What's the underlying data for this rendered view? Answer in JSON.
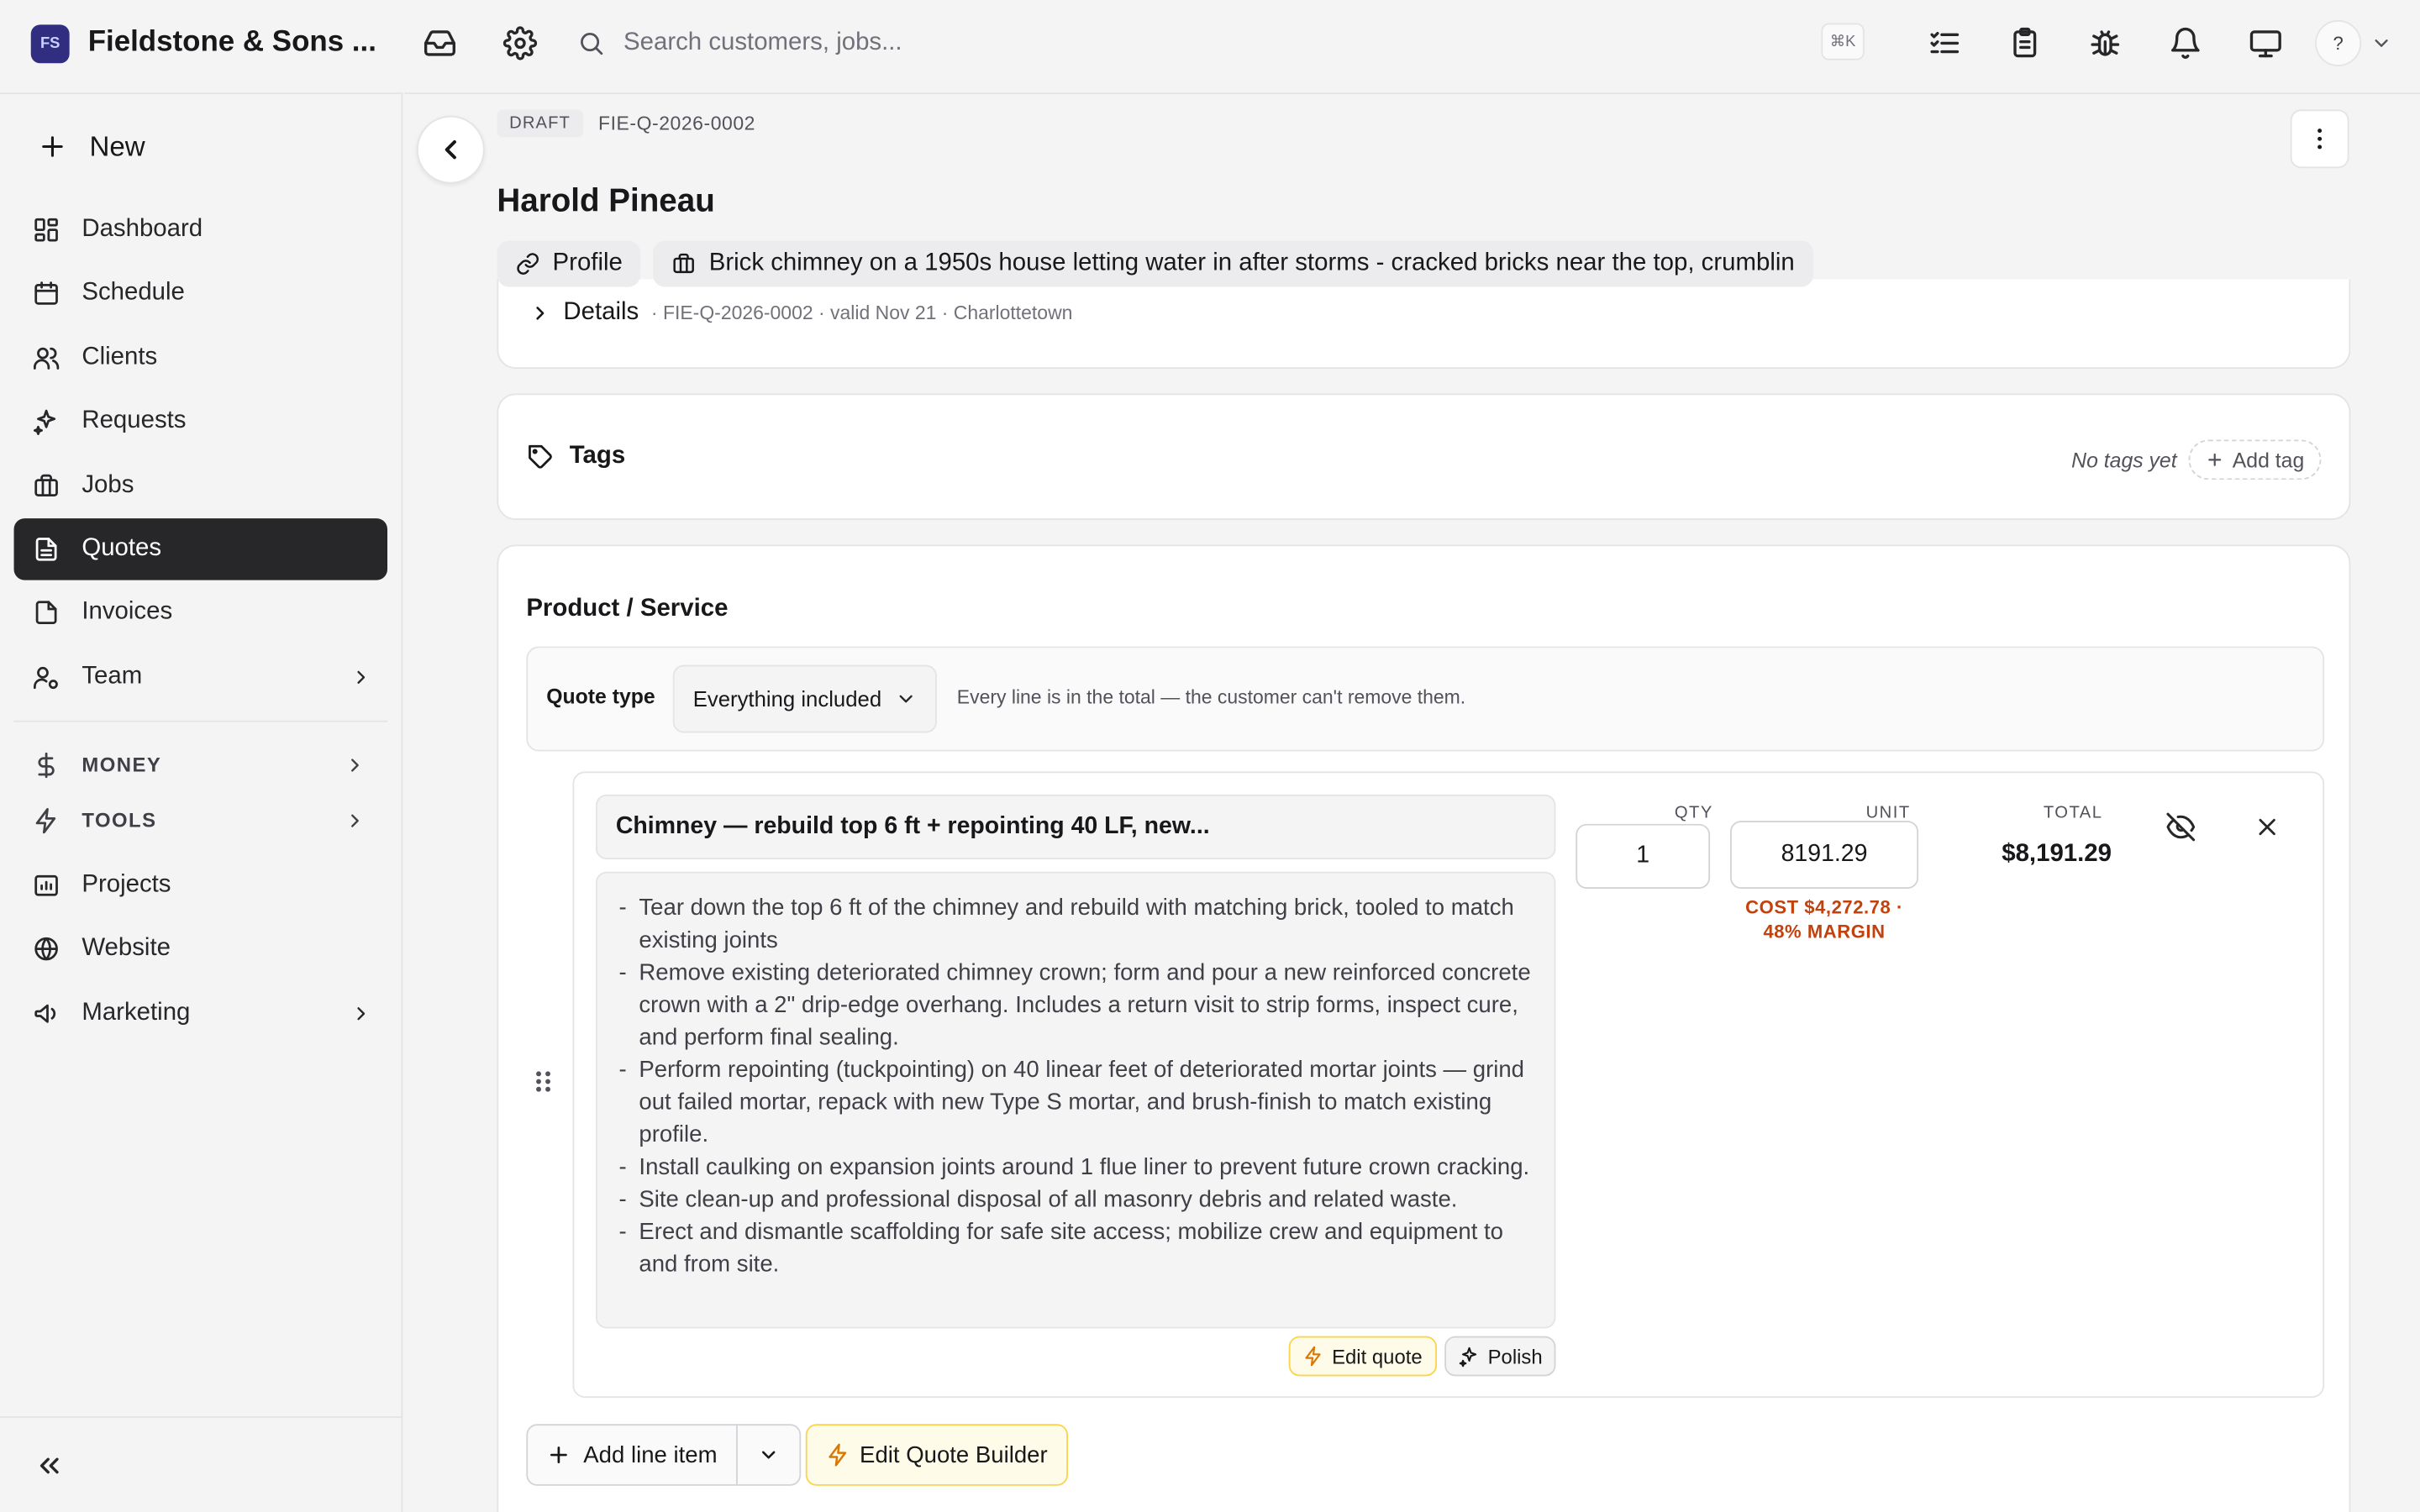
{
  "app": {
    "brand_name": "Fieldstone & Sons ...",
    "brand_logo_text": "FS"
  },
  "topbar": {
    "search_placeholder": "Search customers, jobs...",
    "shortcut": "⌘K",
    "help": "?"
  },
  "sidebar": {
    "new_label": "New",
    "items": [
      {
        "label": "Dashboard"
      },
      {
        "label": "Schedule"
      },
      {
        "label": "Clients"
      },
      {
        "label": "Requests"
      },
      {
        "label": "Jobs"
      },
      {
        "label": "Quotes",
        "active": true
      },
      {
        "label": "Invoices"
      },
      {
        "label": "Team"
      }
    ],
    "sections": [
      {
        "label": "MONEY"
      },
      {
        "label": "TOOLS"
      }
    ],
    "bottom_items": [
      {
        "label": "Projects"
      },
      {
        "label": "Website"
      },
      {
        "label": "Marketing"
      }
    ]
  },
  "quote": {
    "status": "DRAFT",
    "number": "FIE-Q-2026-0002",
    "client_name": "Harold Pineau",
    "chips": {
      "profile": "Profile",
      "job": "Brick chimney on a 1950s house letting water in after storms - cracked bricks near the top, crumblin"
    },
    "details": {
      "label": "Details",
      "meta": "· FIE-Q-2026-0002 · valid Nov 21 · Charlottetown"
    },
    "tags": {
      "label": "Tags",
      "empty": "No tags yet",
      "add": "Add tag"
    },
    "product_service": {
      "title": "Product / Service",
      "quote_type_label": "Quote type",
      "quote_type_value": "Everything included",
      "quote_type_hint": "Every line is in the total — the customer can't remove them.",
      "columns": {
        "qty": "QTY",
        "unit": "UNIT",
        "total": "TOTAL"
      },
      "line_items": [
        {
          "name": "Chimney — rebuild top 6 ft + repointing 40 LF, new...",
          "description": [
            "Tear down the top 6 ft of the chimney and rebuild with matching brick, tooled to match existing joints",
            "Remove existing deteriorated chimney crown; form and pour a new reinforced concrete crown with a 2\" drip-edge overhang. Includes a return visit to strip forms, inspect cure, and perform final sealing.",
            "Perform repointing (tuckpointing) on 40 linear feet of deteriorated mortar joints — grind out failed mortar, repack with new Type S mortar, and brush-finish to match existing profile.",
            "Install caulking on expansion joints around 1 flue liner to prevent future crown cracking.",
            "Site clean-up and professional disposal of all masonry debris and related waste.",
            "Erect and dismantle scaffolding for safe site access; mobilize crew and equipment to and from site."
          ],
          "qty": "1",
          "unit": "8191.29",
          "cost_note": "COST $4,272.78 · 48% MARGIN",
          "total": "$8,191.29",
          "edit_quote": "Edit quote",
          "polish": "Polish"
        }
      ],
      "add_line_item": "Add line item",
      "edit_builder": "Edit Quote Builder"
    }
  },
  "colors": {
    "active_nav": "#27272a",
    "accent_yellow": "#fcd34d",
    "cost_orange": "#c2410c"
  }
}
